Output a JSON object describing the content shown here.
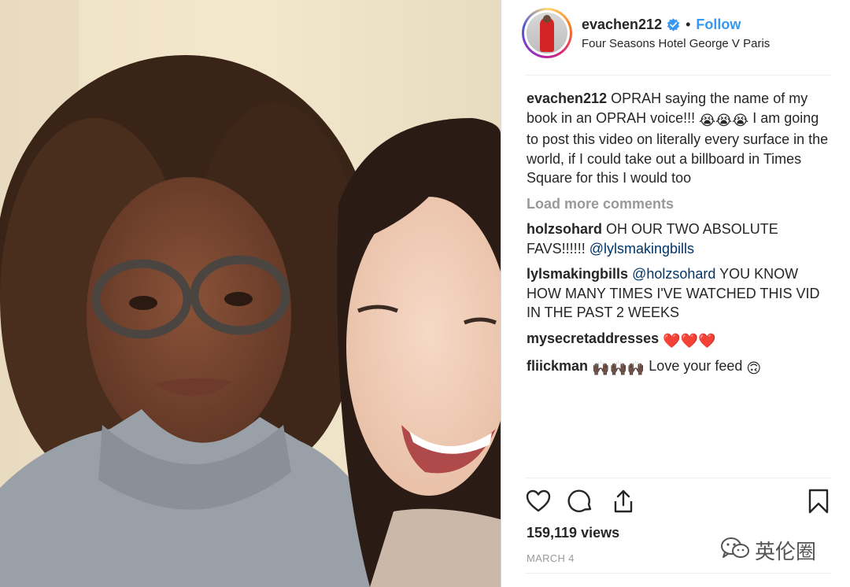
{
  "post": {
    "username": "evachen212",
    "separator": "•",
    "follow_label": "Follow",
    "location": "Four Seasons Hotel George V Paris",
    "verified_icon": "verified-badge-icon"
  },
  "caption": {
    "user": "evachen212",
    "text_a": "OPRAH saying the name of my book in an OPRAH voice!!! ",
    "emojis": "😭😭😭",
    "text_b": " I am going to post this video on literally every surface in the world, if I could take out a billboard in Times Square for this I would too"
  },
  "load_more_label": "Load more comments",
  "comments": [
    {
      "user": "holzsohard",
      "text_a": "OH OUR TWO ABSOLUTE FAVS!!!!!! ",
      "mention": "@lylsmakingbills",
      "text_b": ""
    },
    {
      "user": "lylsmakingbills",
      "text_a": "",
      "mention": "@holzsohard",
      "text_b": " YOU KNOW HOW MANY TIMES I'VE WATCHED THIS VID IN THE PAST 2 WEEKS"
    },
    {
      "user": "mysecretaddresses",
      "text_a": "",
      "emojis": "❤️❤️❤️"
    },
    {
      "user": "fliickman",
      "emojis_a": "🙌🏿🙌🏿🙌🏿",
      "text_a": " Love your feed ",
      "emojis_b": "🙃"
    }
  ],
  "actions": {
    "like_icon": "heart-icon",
    "comment_icon": "comment-icon",
    "share_icon": "share-icon",
    "save_icon": "bookmark-icon"
  },
  "views": "159,119 views",
  "date": "MARCH 4",
  "watermark": {
    "text": "英伦圈",
    "icon": "wechat-icon"
  },
  "colors": {
    "accent": "#3897f0",
    "muted": "#999999",
    "mention": "#003569",
    "text": "#262626"
  }
}
